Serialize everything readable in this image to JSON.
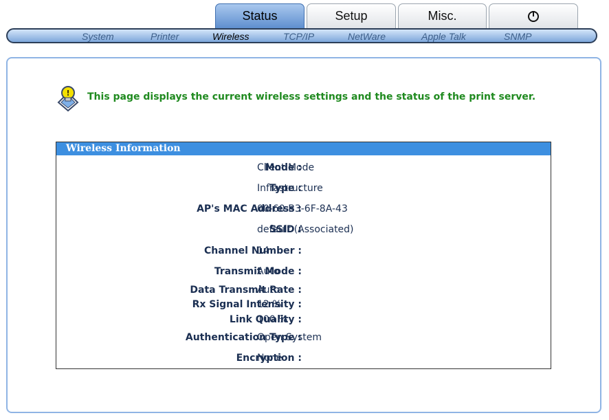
{
  "tabs": [
    {
      "label": "Status",
      "active": true
    },
    {
      "label": "Setup",
      "active": false
    },
    {
      "label": "Misc.",
      "active": false
    },
    {
      "label": "",
      "icon": "power-icon",
      "active": false
    }
  ],
  "subnav": [
    {
      "label": "System",
      "active": false
    },
    {
      "label": "Printer",
      "active": false
    },
    {
      "label": "Wireless",
      "active": true
    },
    {
      "label": "TCP/IP",
      "active": false
    },
    {
      "label": "NetWare",
      "active": false
    },
    {
      "label": "Apple Talk",
      "active": false
    },
    {
      "label": "SNMP",
      "active": false
    }
  ],
  "intro": {
    "icon": "lightbulb-info-icon",
    "text": "This page displays the current wireless settings and the status of the print server."
  },
  "wireless_info": {
    "header": "Wireless Information",
    "rows": [
      {
        "label": "Mode :",
        "value": "Client Mode"
      },
      {
        "label": "Type :",
        "value": "Infrastructure"
      },
      {
        "label": "AP's MAC Address :",
        "value": "00-60-B3-6F-8A-43"
      },
      {
        "label": "SSID :",
        "value": "default (Associated)"
      },
      {
        "label": "Channel Number :",
        "value": "14"
      },
      {
        "label": "Transmit Mode :",
        "value": "Auto"
      },
      {
        "label": "Data Transmit Rate :",
        "value": "Auto"
      },
      {
        "label": "Rx Signal Intensity :",
        "value": "12 %"
      },
      {
        "label": "Link Quality :",
        "value": "100 %"
      },
      {
        "label": "Authentication Type :",
        "value": "Open System"
      },
      {
        "label": "Encryption :",
        "value": "None"
      }
    ]
  },
  "colors": {
    "active_tab": "#5f8fcf",
    "header_bar": "#3d8fe0",
    "intro_text": "#1f8a1f",
    "label_text": "#1b2f52",
    "panel_border": "#8fb4e4"
  }
}
